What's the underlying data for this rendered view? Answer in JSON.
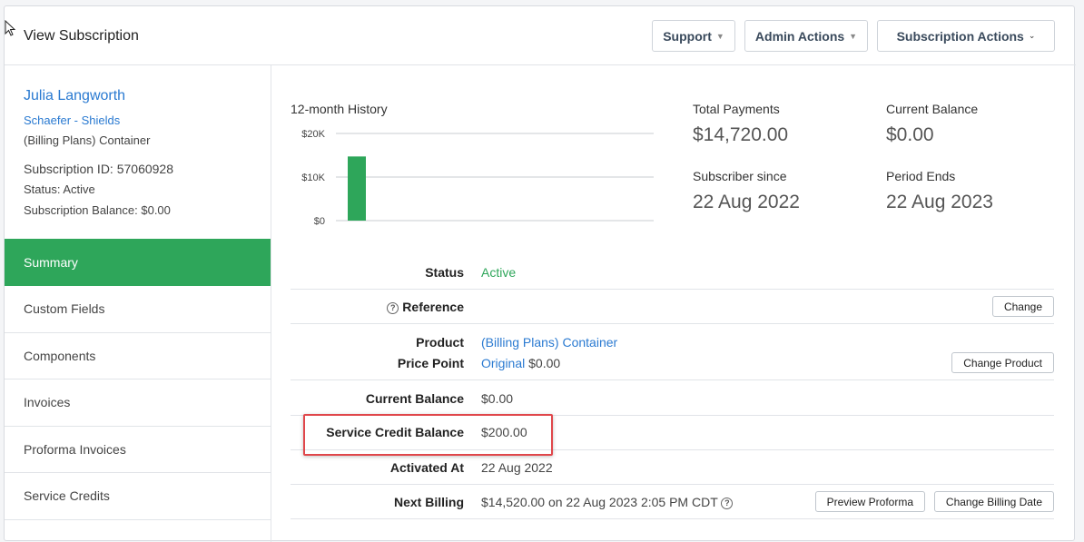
{
  "header": {
    "title": "View Subscription",
    "buttons": {
      "support": "Support",
      "admin": "Admin Actions",
      "subscription": "Subscription Actions"
    }
  },
  "sidebar": {
    "customer_name": "Julia Langworth",
    "organization": "Schaefer - Shields",
    "product": "(Billing Plans) Container",
    "subscription_id": "Subscription ID: 57060928",
    "status": "Status: Active",
    "balance": "Subscription Balance: $0.00",
    "nav": [
      "Summary",
      "Custom Fields",
      "Components",
      "Invoices",
      "Proforma Invoices",
      "Service Credits"
    ],
    "active_nav": "Summary"
  },
  "history": {
    "title": "12-month History",
    "chart_data": {
      "type": "bar",
      "title": "12-month History",
      "y_ticks": [
        "$20K",
        "$10K",
        "$0"
      ],
      "ylim": [
        0,
        20000
      ],
      "values": [
        14720
      ],
      "color": "#2ea65a"
    }
  },
  "stats": {
    "total_payments_label": "Total Payments",
    "total_payments": "$14,720.00",
    "current_balance_label": "Current Balance",
    "current_balance": "$0.00",
    "subscriber_since_label": "Subscriber since",
    "subscriber_since": "22 Aug 2022",
    "period_ends_label": "Period Ends",
    "period_ends": "22 Aug 2023"
  },
  "details": {
    "status_label": "Status",
    "status": "Active",
    "reference_label": "Reference",
    "change_btn": "Change",
    "product_label": "Product",
    "product": "(Billing Plans) Container",
    "price_point_label": "Price Point",
    "price_point_name": "Original",
    "price_point_amount": "$0.00",
    "change_product_btn": "Change Product",
    "current_balance_label": "Current Balance",
    "current_balance": "$0.00",
    "service_credit_label": "Service Credit Balance",
    "service_credit": "$200.00",
    "activated_label": "Activated At",
    "activated": "22 Aug 2022",
    "next_billing_label": "Next Billing",
    "next_billing": "$14,520.00 on 22 Aug 2023 2:05 PM CDT",
    "preview_proforma_btn": "Preview Proforma",
    "change_billing_date_btn": "Change Billing Date"
  },
  "colors": {
    "accent": "#2ea65a",
    "link": "#2a7ad1",
    "highlight": "#e0474b"
  }
}
